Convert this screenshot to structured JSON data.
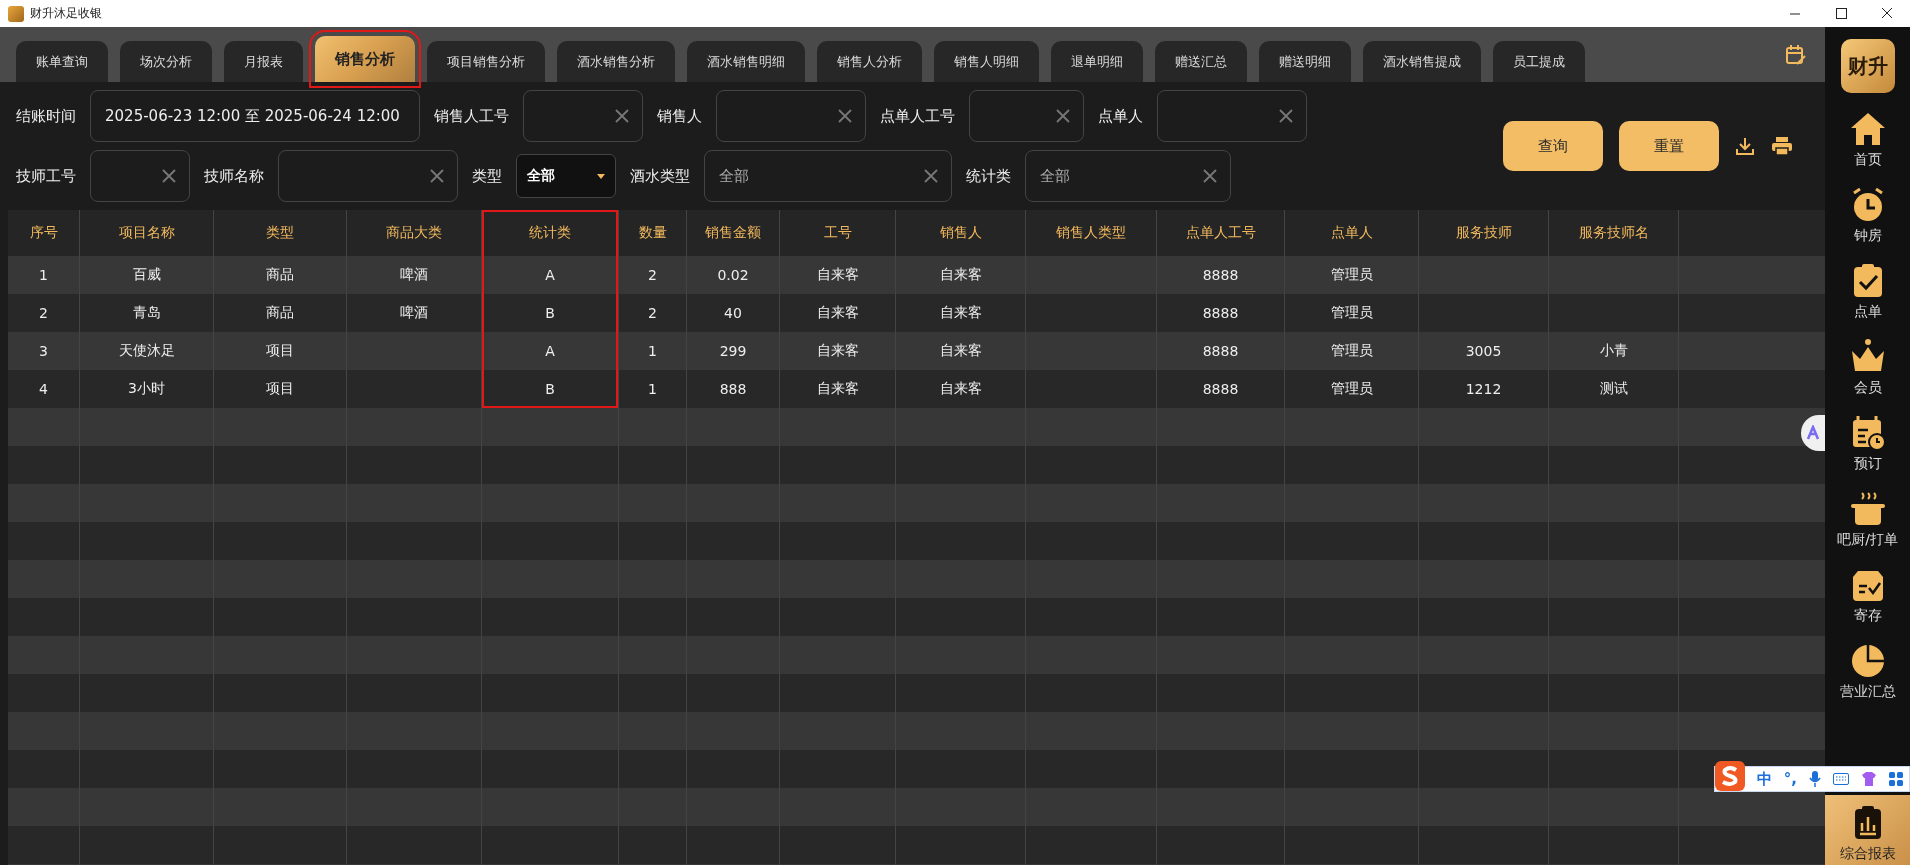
{
  "window": {
    "title": "财升沐足收银"
  },
  "tabs": [
    {
      "label": "账单查询",
      "selected": false,
      "highlighted": false
    },
    {
      "label": "场次分析",
      "selected": false,
      "highlighted": false
    },
    {
      "label": "月报表",
      "selected": false,
      "highlighted": false
    },
    {
      "label": "销售分析",
      "selected": true,
      "highlighted": true
    },
    {
      "label": "项目销售分析",
      "selected": false,
      "highlighted": false
    },
    {
      "label": "酒水销售分析",
      "selected": false,
      "highlighted": false
    },
    {
      "label": "酒水销售明细",
      "selected": false,
      "highlighted": false
    },
    {
      "label": "销售人分析",
      "selected": false,
      "highlighted": false
    },
    {
      "label": "销售人明细",
      "selected": false,
      "highlighted": false
    },
    {
      "label": "退单明细",
      "selected": false,
      "highlighted": false
    },
    {
      "label": "赠送汇总",
      "selected": false,
      "highlighted": false
    },
    {
      "label": "赠送明细",
      "selected": false,
      "highlighted": false
    },
    {
      "label": "酒水销售提成",
      "selected": false,
      "highlighted": false
    },
    {
      "label": "员工提成",
      "selected": false,
      "highlighted": false
    }
  ],
  "filters": [
    [
      {
        "kind": "text",
        "label": "结账时间",
        "value": "2025-06-23 12:00 至 2025-06-24 12:00",
        "clearable": false
      },
      {
        "kind": "text",
        "label": "销售人工号",
        "clearable": true
      },
      {
        "kind": "text",
        "label": "销售人",
        "clearable": true
      },
      {
        "kind": "text",
        "label": "点单人工号",
        "clearable": true
      },
      {
        "kind": "text",
        "label": "点单人",
        "clearable": true
      }
    ],
    [
      {
        "kind": "text",
        "label": "技师工号",
        "clearable": true
      },
      {
        "kind": "text",
        "label": "技师名称",
        "clearable": true
      },
      {
        "kind": "select",
        "label": "类型",
        "value": "全部"
      },
      {
        "kind": "text",
        "label": "酒水类型",
        "placeholder": "全部",
        "clearable": true
      },
      {
        "kind": "text",
        "label": "统计类",
        "placeholder": "全部",
        "clearable": true
      }
    ]
  ],
  "actions": [
    "查询",
    "重置"
  ],
  "table": {
    "columns": [
      {
        "label": "序号",
        "highlighted": false
      },
      {
        "label": "项目名称",
        "highlighted": false
      },
      {
        "label": "类型",
        "highlighted": false
      },
      {
        "label": "商品大类",
        "highlighted": false
      },
      {
        "label": "统计类",
        "highlighted": true
      },
      {
        "label": "数量",
        "highlighted": false
      },
      {
        "label": "销售金额",
        "highlighted": false
      },
      {
        "label": "工号",
        "highlighted": false
      },
      {
        "label": "销售人",
        "highlighted": false
      },
      {
        "label": "销售人类型",
        "highlighted": false
      },
      {
        "label": "点单人工号",
        "highlighted": false
      },
      {
        "label": "点单人",
        "highlighted": false
      },
      {
        "label": "服务技师",
        "highlighted": false
      },
      {
        "label": "服务技师名",
        "highlighted": false
      }
    ],
    "rows": [
      [
        "1",
        "百威",
        "商品",
        "啤酒",
        "A",
        "2",
        "0.02",
        "自来客",
        "自来客",
        "",
        "8888",
        "管理员",
        "",
        ""
      ],
      [
        "2",
        "青岛",
        "商品",
        "啤酒",
        "B",
        "2",
        "40",
        "自来客",
        "自来客",
        "",
        "8888",
        "管理员",
        "",
        ""
      ],
      [
        "3",
        "天使沐足",
        "项目",
        "",
        "A",
        "1",
        "299",
        "自来客",
        "自来客",
        "",
        "8888",
        "管理员",
        "3005",
        "小青"
      ],
      [
        "4",
        "3小时",
        "项目",
        "",
        "B",
        "1",
        "888",
        "自来客",
        "自来客",
        "",
        "8888",
        "管理员",
        "1212",
        "测试"
      ]
    ]
  },
  "sidebar": {
    "logo": "财升",
    "items": [
      {
        "kind": "home",
        "label": "首页",
        "selected": false
      },
      {
        "kind": "clock",
        "label": "钟房",
        "selected": false
      },
      {
        "kind": "order",
        "label": "点单",
        "selected": false
      },
      {
        "kind": "crown",
        "label": "会员",
        "selected": false
      },
      {
        "kind": "booking",
        "label": "预订",
        "selected": false
      },
      {
        "kind": "pot",
        "label": "吧厨/打单",
        "selected": false
      },
      {
        "kind": "storage",
        "label": "寄存",
        "selected": false
      },
      {
        "kind": "pie",
        "label": "营业汇总",
        "selected": false
      },
      {
        "kind": "report",
        "label": "综合报表",
        "selected": true
      }
    ]
  },
  "ime_toolbar": {
    "mode": "中",
    "punctuation": "°,"
  }
}
